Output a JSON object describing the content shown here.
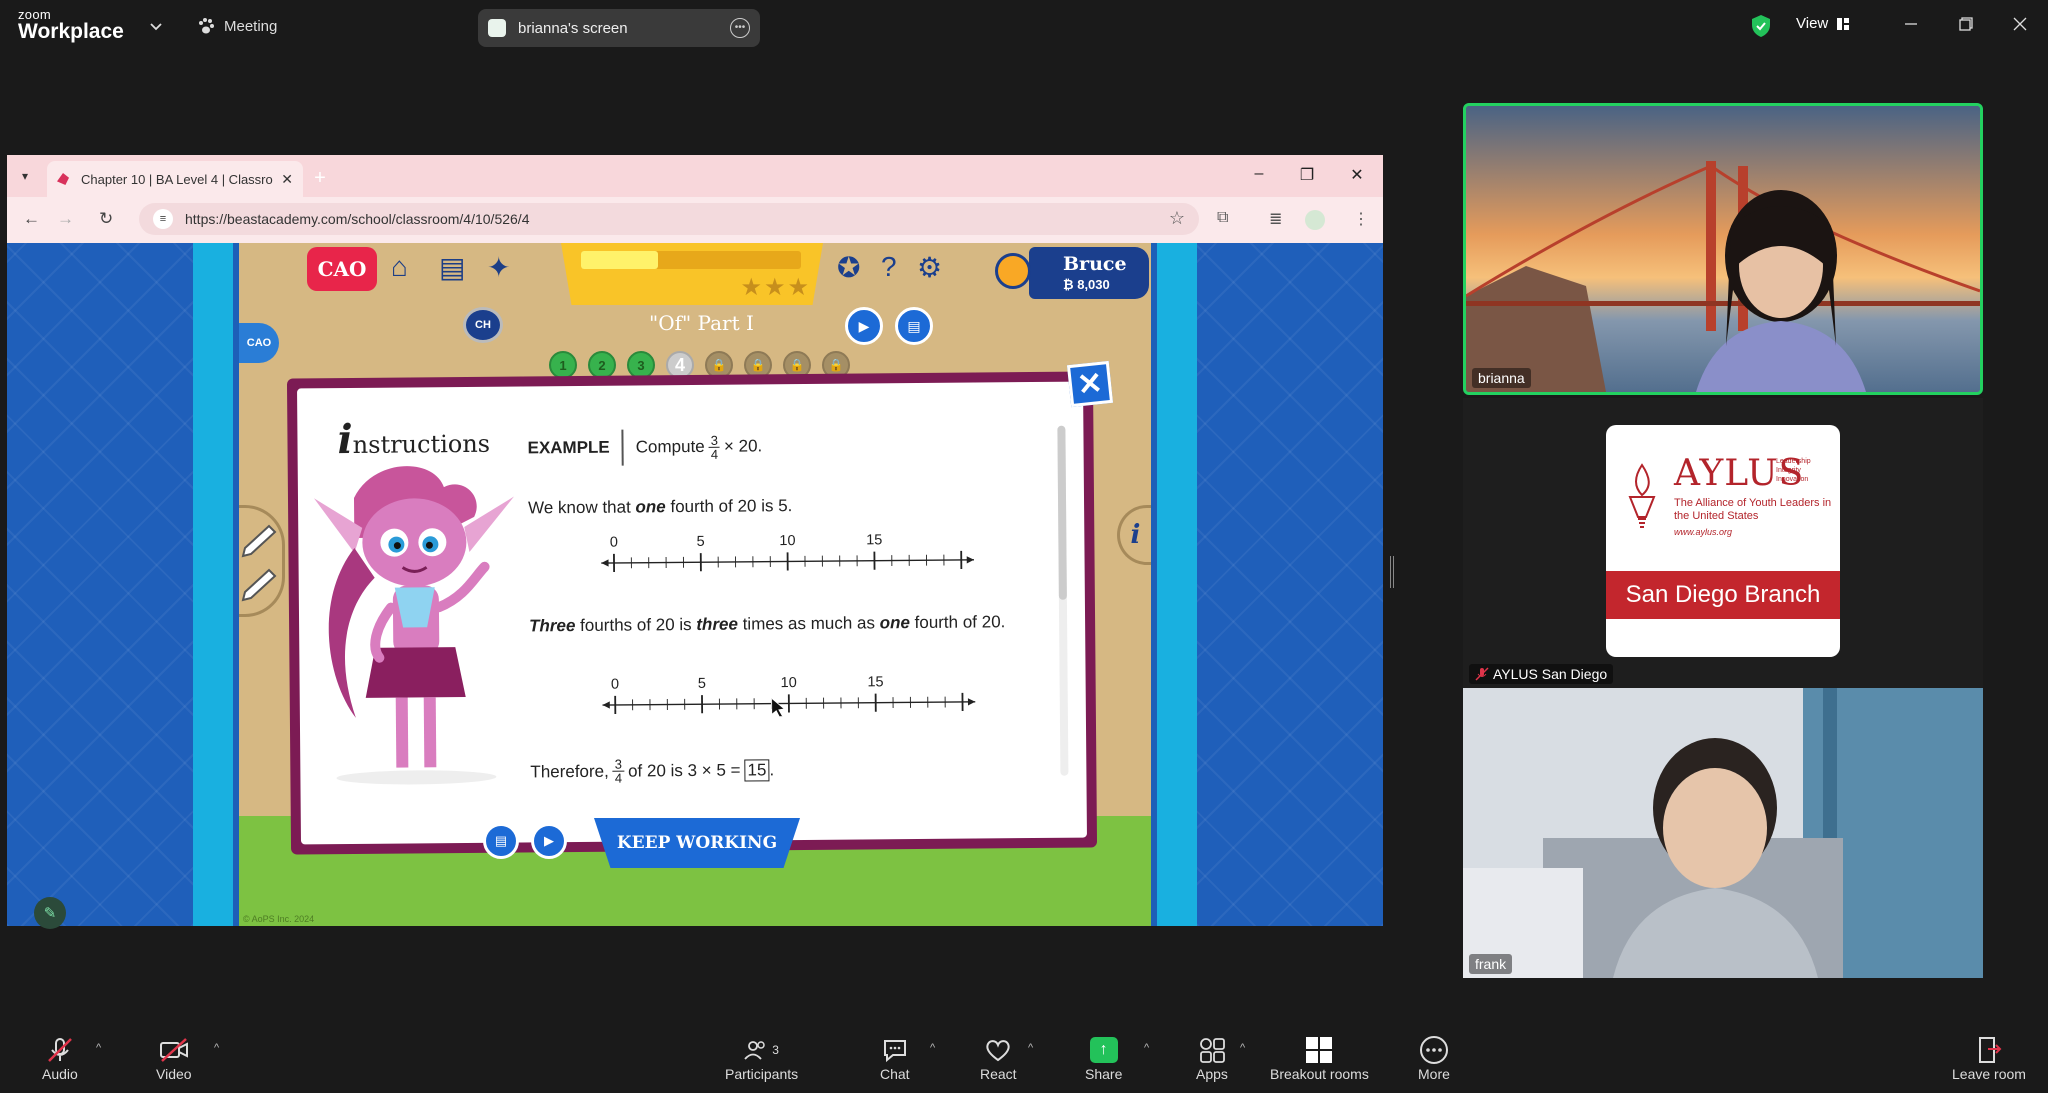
{
  "app": {
    "logo_top": "zoom",
    "logo_bottom": "Workplace",
    "meeting_label": "Meeting",
    "shared_screen_label": "brianna's screen",
    "view_label": "View"
  },
  "browser": {
    "tab_title": "Chapter 10 | BA Level 4 | Classro",
    "url": "https://beastacademy.com/school/classroom/4/10/526/4"
  },
  "game": {
    "student_name": "Bruce",
    "student_points": "8,030",
    "lesson_title": "\"Of\" Part I",
    "ch_badge": "CH",
    "cao_label": "CAO",
    "progress_fill_fraction": 0.35,
    "steps": [
      {
        "label": "1",
        "state": "done"
      },
      {
        "label": "2",
        "state": "done"
      },
      {
        "label": "3",
        "state": "done"
      },
      {
        "label": "4",
        "state": "current"
      },
      {
        "label": "",
        "state": "locked"
      },
      {
        "label": "",
        "state": "locked"
      },
      {
        "label": "",
        "state": "locked"
      },
      {
        "label": "",
        "state": "locked"
      }
    ],
    "instructions_initial": "i",
    "instructions_title": "nstructions",
    "example_label": "EXAMPLE",
    "example_text": "Compute",
    "frac_num": "3",
    "frac_den": "4",
    "example_times": "× 20.",
    "line1": "We know that one fourth of 20 is 5.",
    "line1_pre": "We know that ",
    "line1_em": "one",
    "line1_post": " fourth of 20 is 5.",
    "line2_a": "Three",
    "line2_b": " fourths of 20 is ",
    "line2_c": "three",
    "line2_d": " times as much as ",
    "line2_e": "one",
    "line2_f": " fourth of 20.",
    "line3_pre": "Therefore, ",
    "line3_mid": "of 20 is 3 × 5 =",
    "line3_answer": "15",
    "line3_end": ".",
    "numberline_labels": [
      "0",
      "5",
      "10",
      "15"
    ],
    "keep_working": "KEEP WORKING",
    "copyright": "© AoPS Inc. 2024",
    "info_label": "i"
  },
  "participants": [
    {
      "name": "brianna"
    },
    {
      "name": "AYLUS San Diego"
    },
    {
      "name": "frank"
    }
  ],
  "aylus_card": {
    "heading": "AYLUS",
    "tagline": [
      "Leadership",
      "Integrity",
      "Innovation"
    ],
    "subtitle": "The Alliance of Youth Leaders in the United States",
    "website": "www.aylus.org",
    "branch": "San Diego Branch"
  },
  "toolbar": {
    "audio": "Audio",
    "video": "Video",
    "participants": "Participants",
    "participants_count": "3",
    "chat": "Chat",
    "react": "React",
    "share": "Share",
    "apps": "Apps",
    "breakout": "Breakout rooms",
    "more": "More",
    "leave": "Leave room"
  },
  "colors": {
    "active_speaker_border": "#23d160",
    "share_green": "#23c25a",
    "muted_red": "#e0344a"
  }
}
